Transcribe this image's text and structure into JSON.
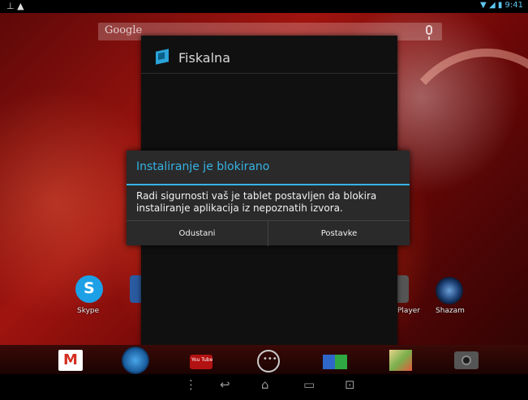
{
  "status_bar": {
    "left_icons": "⊥ ▲",
    "time": "9:41"
  },
  "search": {
    "logo": "Google"
  },
  "app_panel": {
    "title": "Fiskalna"
  },
  "home_icons": [
    {
      "name": "skype-icon",
      "label": "Skype"
    },
    {
      "name": "player-icon",
      "label": "Player"
    },
    {
      "name": "shazam-icon",
      "label": "Shazam"
    }
  ],
  "dialog": {
    "title": "Instaliranje je blokirano",
    "message": "Radi sigurnosti vaš je tablet postavljen da blokira instaliranje aplikacija iz nepoznatih izvora.",
    "cancel_label": "Odustani",
    "settings_label": "Postavke"
  },
  "dock": {
    "youtube_label": "You Tube"
  },
  "colors": {
    "accent": "#35b3e5",
    "dialog_bg": "#2a2a2a"
  }
}
